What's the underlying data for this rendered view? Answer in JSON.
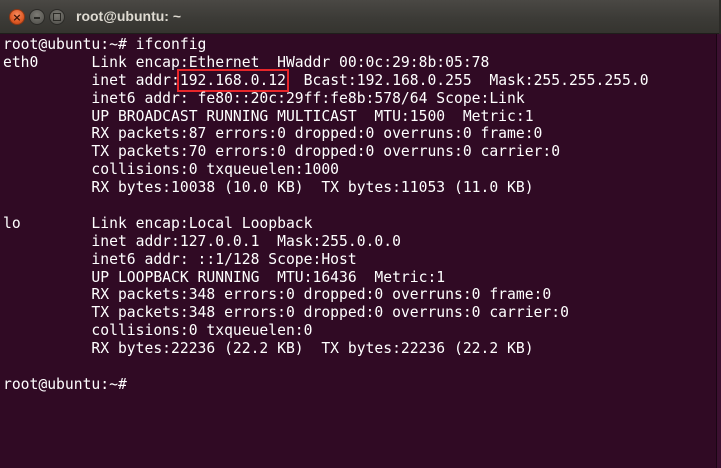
{
  "window": {
    "title": "root@ubuntu: ~",
    "close_glyph": "×",
    "highlight_color": "#e8262a",
    "background_color": "#300a24"
  },
  "terminal": {
    "lines": [
      "root@ubuntu:~# ifconfig",
      "eth0      Link encap:Ethernet  HWaddr 00:0c:29:8b:05:78",
      {
        "prefix": "          inet addr:",
        "highlight": "192.168.0.12",
        "suffix": "  Bcast:192.168.0.255  Mask:255.255.255.0"
      },
      "          inet6 addr: fe80::20c:29ff:fe8b:578/64 Scope:Link",
      "          UP BROADCAST RUNNING MULTICAST  MTU:1500  Metric:1",
      "          RX packets:87 errors:0 dropped:0 overruns:0 frame:0",
      "          TX packets:70 errors:0 dropped:0 overruns:0 carrier:0",
      "          collisions:0 txqueuelen:1000",
      "          RX bytes:10038 (10.0 KB)  TX bytes:11053 (11.0 KB)",
      "",
      "lo        Link encap:Local Loopback",
      "          inet addr:127.0.0.1  Mask:255.0.0.0",
      "          inet6 addr: ::1/128 Scope:Host",
      "          UP LOOPBACK RUNNING  MTU:16436  Metric:1",
      "          RX packets:348 errors:0 dropped:0 overruns:0 frame:0",
      "          TX packets:348 errors:0 dropped:0 overruns:0 carrier:0",
      "          collisions:0 txqueuelen:0",
      "          RX bytes:22236 (22.2 KB)  TX bytes:22236 (22.2 KB)",
      "",
      "root@ubuntu:~# "
    ]
  }
}
